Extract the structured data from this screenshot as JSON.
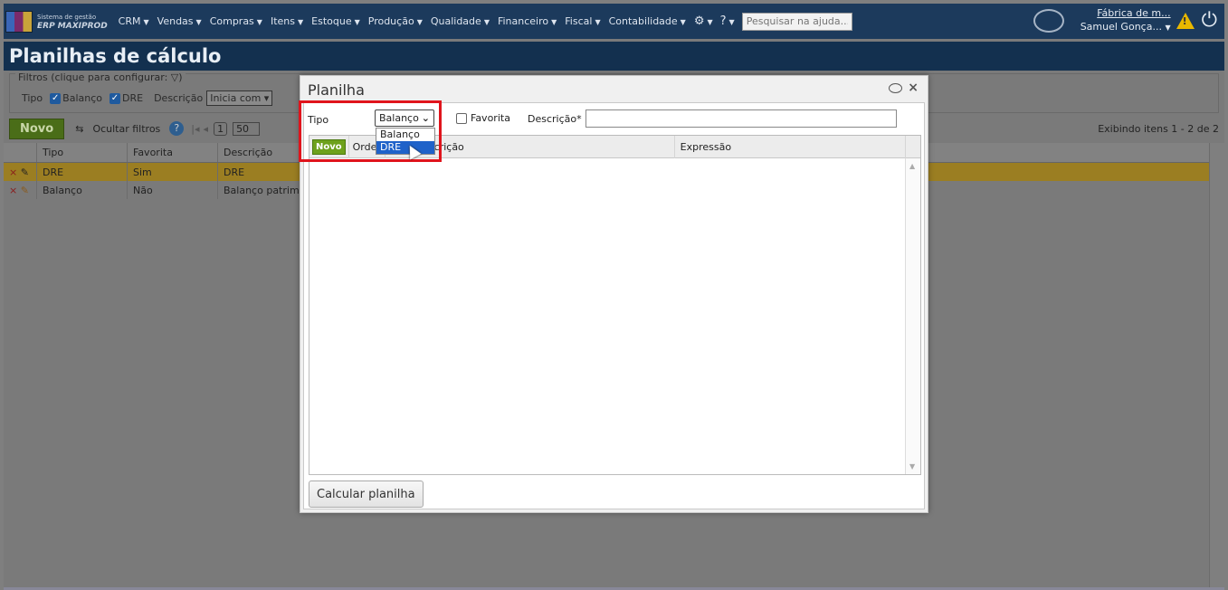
{
  "topbar": {
    "brand_line1": "Sistema de gestão",
    "brand_line2": "ERP MAXIPROD",
    "menu": [
      "CRM",
      "Vendas",
      "Compras",
      "Itens",
      "Estoque",
      "Produção",
      "Qualidade",
      "Financeiro",
      "Fiscal",
      "Contabilidade"
    ],
    "help_placeholder": "Pesquisar na ajuda...",
    "company": "Fábrica de m...",
    "user": "Samuel Gonça..."
  },
  "page": {
    "title": "Planilhas de cálculo",
    "filters_legend": "Filtros (clique para configurar:",
    "filters_legend_end": ")",
    "filter_tipo_label": "Tipo",
    "filter_balanco": "Balanço",
    "filter_dre": "DRE",
    "filter_descricao_label": "Descrição",
    "filter_descricao_mode": "Inicia com",
    "toolbar_novo": "Novo",
    "toolbar_hide_filters": "Ocultar filtros",
    "toolbar_page": "1",
    "toolbar_page_size": "50",
    "toolbar_showing": "Exibindo itens 1 - 2 de 2",
    "grid_columns": [
      "Tipo",
      "Favorita",
      "Descrição"
    ],
    "grid_rows": [
      {
        "tipo": "DRE",
        "favorita": "Sim",
        "descricao": "DRE"
      },
      {
        "tipo": "Balanço",
        "favorita": "Não",
        "descricao": "Balanço patrim"
      }
    ]
  },
  "modal": {
    "title": "Planilha",
    "tipo_label": "Tipo",
    "tipo_value": "Balanço",
    "tipo_options": [
      "Balanço",
      "DRE"
    ],
    "tipo_highlighted": "DRE",
    "favorita_label": "Favorita",
    "descricao_label": "Descrição*",
    "descricao_value": "",
    "grid_novo": "Novo",
    "grid_col_ordem": "Orde",
    "grid_col_descricao": "crição",
    "grid_col_expressao": "Expressão",
    "calc_button": "Calcular planilha"
  },
  "colors": {
    "topbar": "#1c3a5c",
    "accent_green": "#6ea11c",
    "highlight_red": "#e0141c",
    "selection_blue": "#1f62c9"
  }
}
